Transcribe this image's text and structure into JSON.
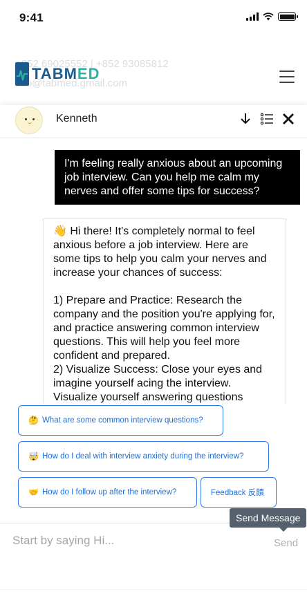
{
  "status_bar": {
    "time": "9:41"
  },
  "site": {
    "background_lines": [
      "+852 69025552 | +852 93085812",
      "info@tabmed.gmail.com"
    ],
    "logo": {
      "main": "TABM",
      "tail": "ED"
    },
    "colors": {
      "logo_blue": "#1b5b8e",
      "logo_teal": "#2ab3a6"
    }
  },
  "chat": {
    "agent_name": "Kenneth",
    "user_message": "I'm feeling really anxious about an upcoming job interview. Can you help me calm my nerves and offer some tips for success?",
    "bot_message": "👋 Hi there! It's completely normal to feel anxious before a job interview. Here are some tips to help you calm your nerves and increase your chances of success:\n\n1) Prepare and Practice: Research the company and the position you're applying for, and practice answering common interview questions. This will help you feel more confident and prepared.\n2) Visualize Success: Close your eyes and imagine yourself acing the interview. Visualize yourself answering questions",
    "suggestions": [
      {
        "emoji": "🤔",
        "label": "What are some common interview questions?"
      },
      {
        "emoji": "🤯",
        "label": "How do I deal with interview anxiety during the interview?"
      },
      {
        "emoji": "🤝",
        "label": "How do I follow up after the interview?"
      },
      {
        "emoji": "",
        "label": "Feedback 反饋"
      }
    ],
    "input_placeholder": "Start by saying Hi...",
    "send_label": "Send",
    "send_tooltip": "Send Message",
    "colors": {
      "accent": "#2f7be8",
      "user_bubble": "#000000",
      "tooltip": "#56606c"
    }
  }
}
